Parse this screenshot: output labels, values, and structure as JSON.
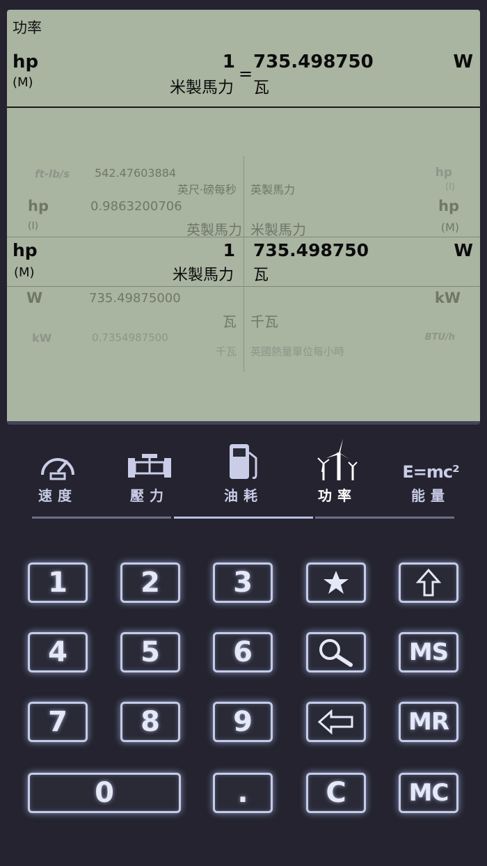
{
  "display": {
    "title": "功率",
    "top": {
      "unit_symbol": "hp",
      "unit_sub": "(M)",
      "value": "1",
      "unit_name": "米製馬力",
      "equals": "=",
      "result": "735.498750",
      "result_unit_name": "瓦",
      "result_unit_symbol": "W"
    },
    "ghost_rows": [
      {
        "sym": "ft-lb/s",
        "value": "542.47603884",
        "name": "英尺·磅每秒",
        "right_name": "英製馬力",
        "right_sym": "hp",
        "right_sub": "(I)"
      },
      {
        "sym": "hp",
        "sub": "(I)",
        "value": "0.9863200706",
        "name": "英製馬力",
        "right_name": "米製馬力",
        "right_sym": "hp",
        "right_sub": "(M)"
      }
    ],
    "selected": {
      "unit_symbol": "hp",
      "unit_sub": "(M)",
      "value": "1",
      "unit_name": "米製馬力",
      "result": "735.498750",
      "result_unit_name": "瓦",
      "result_unit_symbol": "W"
    },
    "below_rows": [
      {
        "sym": "W",
        "value": "735.49875000",
        "name": "瓦",
        "right_name": "千瓦",
        "right_sym": "kW"
      },
      {
        "sym": "kW",
        "value": "0.7354987500",
        "name": "千瓦",
        "right_name": "英國熱量單位每小時",
        "right_sym": "BTU/h"
      }
    ]
  },
  "tabs": [
    {
      "label": "速度",
      "icon": "speedometer-icon"
    },
    {
      "label": "壓力",
      "icon": "pressure-gauge-icon"
    },
    {
      "label": "油耗",
      "icon": "fuel-pump-icon"
    },
    {
      "label": "功率",
      "icon": "wind-turbine-icon"
    },
    {
      "label": "能量",
      "icon": "emc2-icon",
      "glyph": "E=mc²"
    }
  ],
  "active_tab": 3,
  "keys": {
    "k1": "1",
    "k2": "2",
    "k3": "3",
    "k4": "4",
    "k5": "5",
    "k6": "6",
    "k7": "7",
    "k8": "8",
    "k9": "9",
    "k0": "0",
    "dot": ".",
    "clear": "C",
    "ms": "MS",
    "mr": "MR",
    "mc": "MC"
  }
}
